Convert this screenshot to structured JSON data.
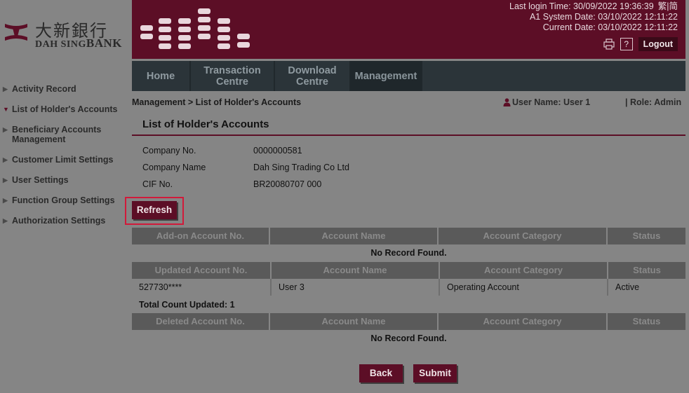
{
  "logo": {
    "chinese": "大新銀行",
    "english_prefix": "DAH SING",
    "english_suffix": "BANK"
  },
  "banner": {
    "last_login": "Last login Time: 30/09/2022 19:36:39",
    "lang_trad": "繁",
    "lang_sep": "|",
    "lang_simp": "简",
    "system_date": "A1 System Date: 03/10/2022 12:11:22",
    "current_date": "Current Date: 03/10/2022 12:11:22",
    "help_label": "?",
    "logout_label": "Logout"
  },
  "nav": {
    "home": "Home",
    "transaction": [
      "Transaction",
      "Centre"
    ],
    "download": [
      "Download",
      "Centre"
    ],
    "management": "Management"
  },
  "sidebar": {
    "items": [
      {
        "label": "Activity Record"
      },
      {
        "label": "List of Holder's Accounts"
      },
      {
        "label": [
          "Beneficiary Accounts",
          "Management"
        ]
      },
      {
        "label": "Customer Limit Settings"
      },
      {
        "label": "User Settings"
      },
      {
        "label": "Function Group Settings"
      },
      {
        "label": "Authorization Settings"
      }
    ]
  },
  "breadcrumb": "Management > List of Holder's Accounts",
  "user": {
    "name": "User Name: User 1",
    "role": "| Role: Admin"
  },
  "page_title": "List of Holder's Accounts",
  "company": {
    "no_label": "Company No.",
    "no_value": "0000000581",
    "name_label": "Company Name",
    "name_value": "Dah Sing Trading Co Ltd",
    "cif_label": "CIF No.",
    "cif_value": "BR20080707 000"
  },
  "buttons": {
    "refresh": "Refresh",
    "back": "Back",
    "submit": "Submit"
  },
  "addon_table": {
    "headers": [
      "Add-on Account No.",
      "Account Name",
      "Account Category",
      "Status"
    ],
    "empty": "No Record Found."
  },
  "updated_table": {
    "headers": [
      "Updated Account No.",
      "Account Name",
      "Account Category",
      "Status"
    ],
    "rows": [
      [
        "527730****",
        "User 3",
        "Operating Account",
        "Active"
      ]
    ],
    "total_label": "Total Count Updated:",
    "total_value": "1"
  },
  "deleted_table": {
    "headers": [
      "Deleted Account No.",
      "Account Name",
      "Account Category",
      "Status"
    ],
    "empty": "No Record Found."
  },
  "colors": {
    "brand": "#5c0e26",
    "nav_bg": "#2b3439",
    "highlight": "#d11a3a"
  }
}
